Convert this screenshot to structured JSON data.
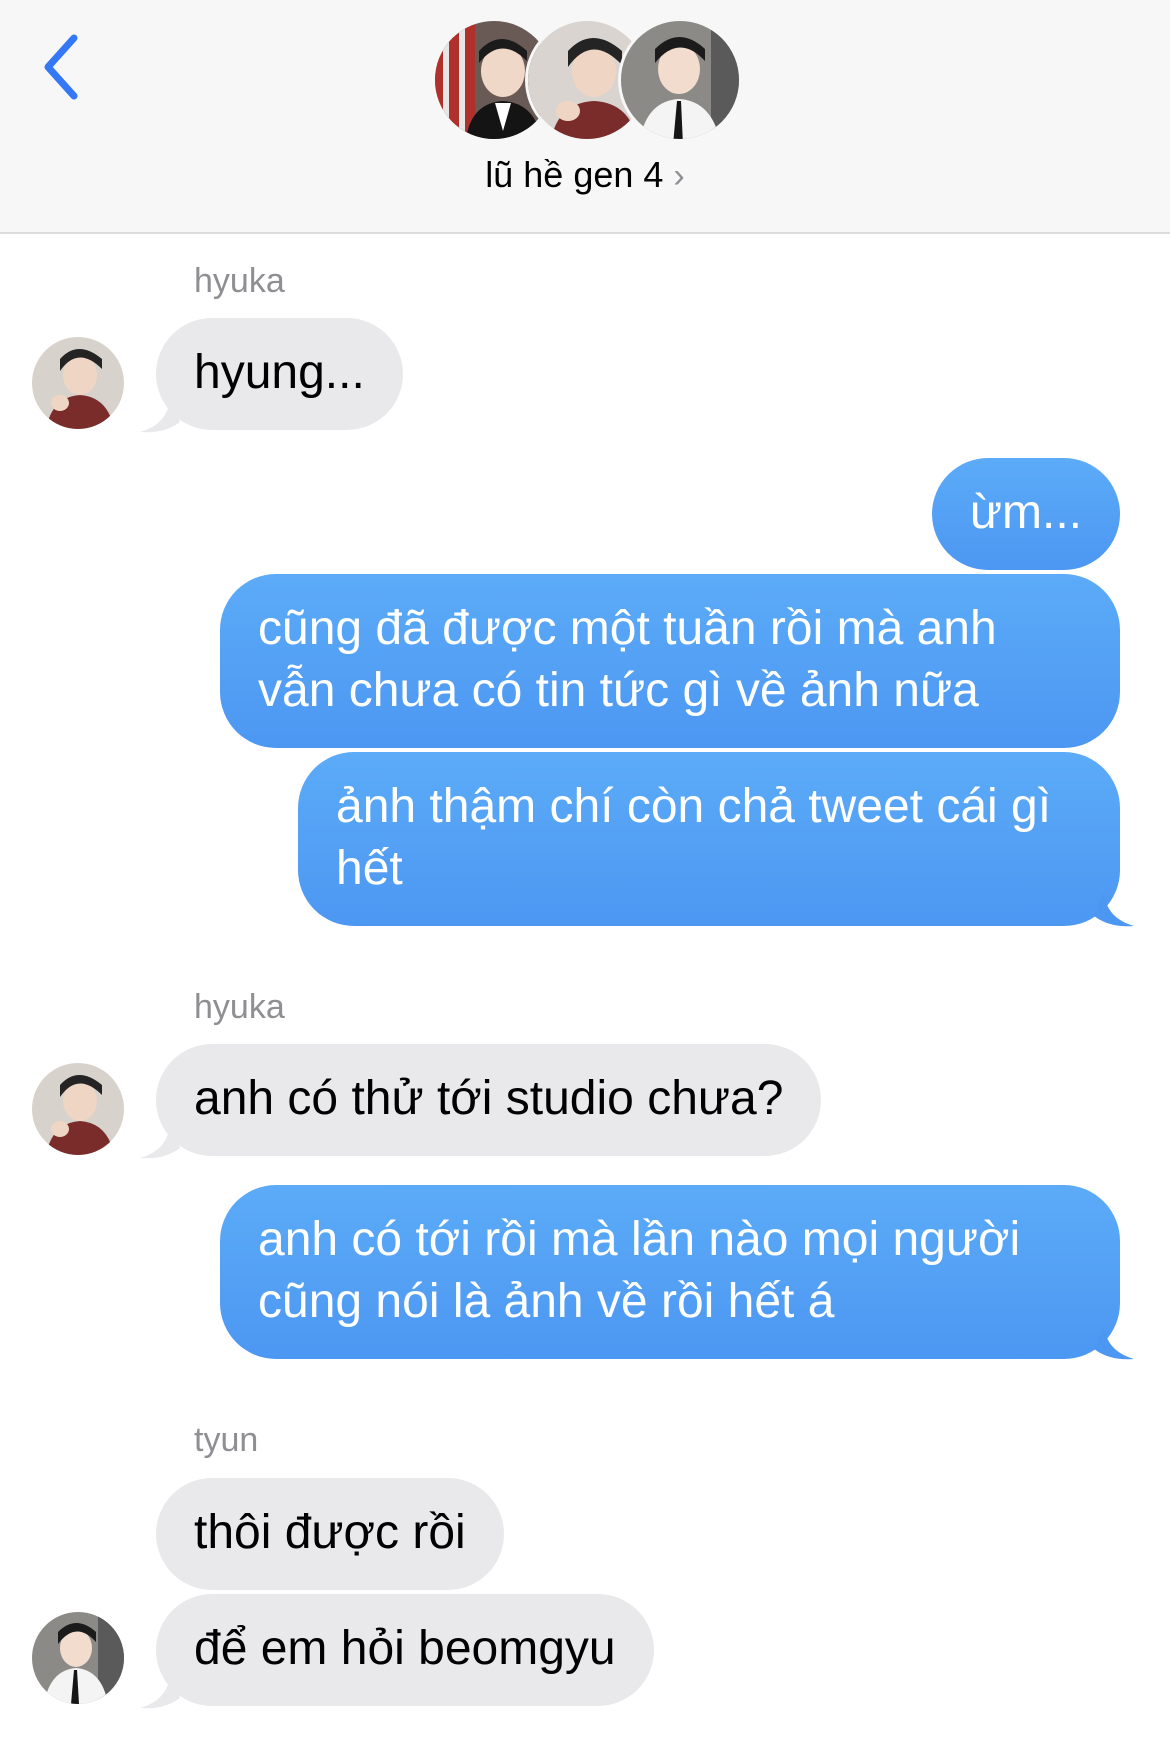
{
  "header": {
    "title": "lũ hề gen 4",
    "chevron": "›",
    "back_icon": "chevron-left-icon",
    "accent": "#3478f6"
  },
  "messages": [
    {
      "sender": "hyuka",
      "text": "hyung..."
    },
    {
      "text": "ừm..."
    },
    {
      "text": "cũng đã được một tuần rồi mà anh vẫn chưa có tin tức gì về ảnh nữa"
    },
    {
      "text": "ảnh thậm chí còn chả tweet cái gì hết"
    },
    {
      "sender": "hyuka",
      "text": "anh có thử tới studio chưa?"
    },
    {
      "text": "anh có tới rồi mà lần nào mọi người cũng nói là ảnh về rồi hết á"
    },
    {
      "sender": "tyun",
      "text": "thôi được rồi"
    },
    {
      "text": "để em hỏi beomgyu"
    }
  ],
  "colors": {
    "incoming_bubble": "#e9e9eb",
    "outgoing_bubble": "#4f9cf4",
    "sender_label": "#8e8e93"
  }
}
